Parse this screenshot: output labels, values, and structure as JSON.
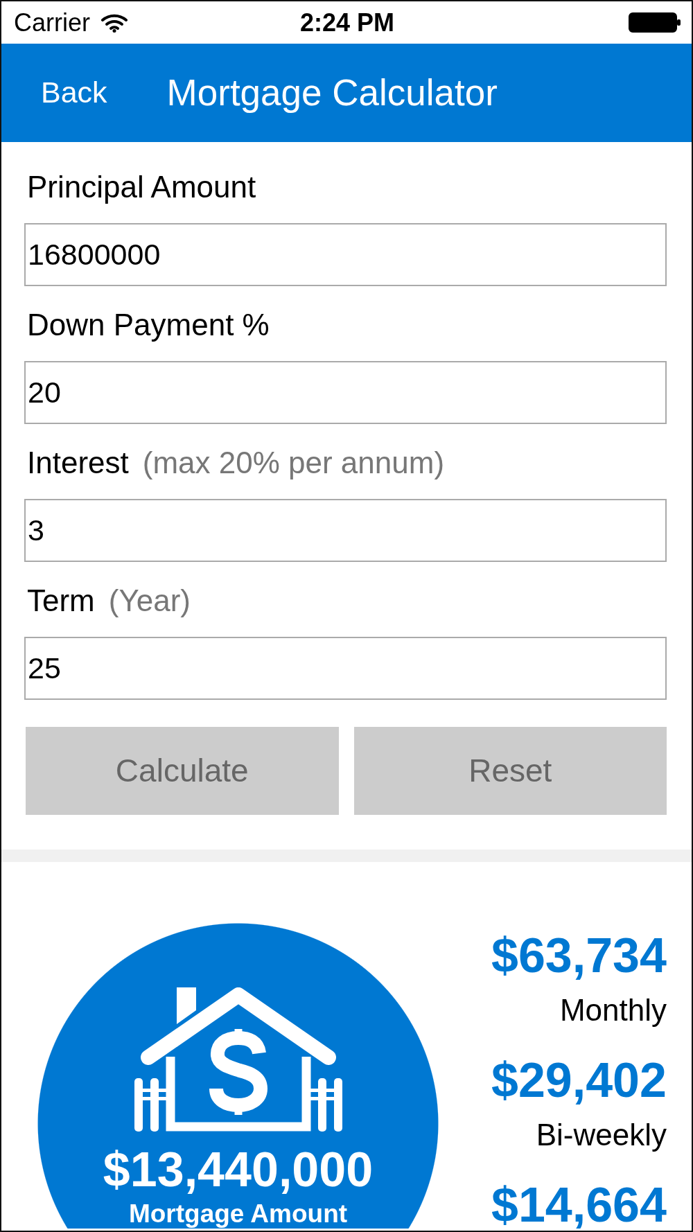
{
  "status_bar": {
    "carrier": "Carrier",
    "time": "2:24 PM"
  },
  "nav_bar": {
    "back": "Back",
    "title": "Mortgage Calculator"
  },
  "form": {
    "fields": [
      {
        "label": "Principal Amount",
        "value": "16800000"
      },
      {
        "label": "Down Payment %",
        "value": "20"
      },
      {
        "label": "Interest",
        "note": "(max 20% per annum)",
        "value": "3"
      },
      {
        "label": "Term",
        "note": "(Year)",
        "value": "25"
      }
    ],
    "buttons": [
      "Calculate",
      "Reset"
    ]
  },
  "result": {
    "mortgage_amount": "$13,440,000",
    "mortgage_label": "Mortgage Amount",
    "payments": [
      {
        "amount": "$63,734",
        "period": "Monthly"
      },
      {
        "amount": "$29,402",
        "period": "Bi-weekly"
      },
      {
        "amount": "$14,664"
      }
    ]
  }
}
